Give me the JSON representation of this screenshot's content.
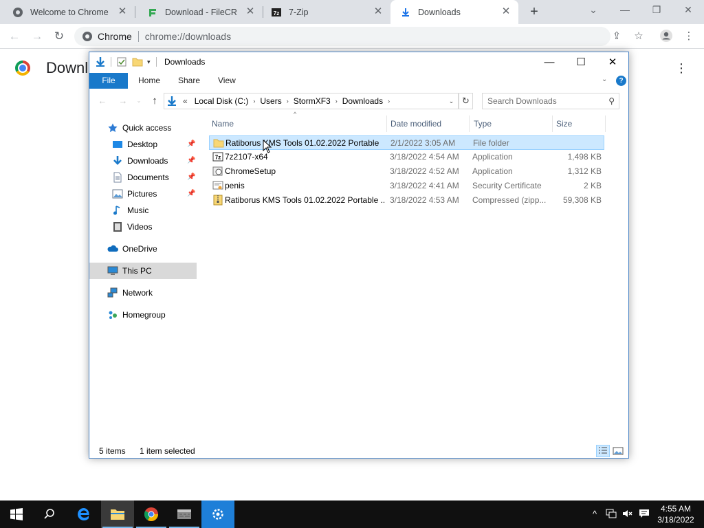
{
  "browser": {
    "tabs": [
      {
        "title": "Welcome to Chrome",
        "favicon": "chrome-icon"
      },
      {
        "title": "Download - FileCR",
        "favicon": "filecr-icon"
      },
      {
        "title": "7-Zip",
        "favicon": "7zip-icon"
      },
      {
        "title": "Downloads",
        "favicon": "download-icon",
        "active": true
      }
    ],
    "omnibox": {
      "site": "Chrome",
      "url": "chrome://downloads"
    },
    "page_title": "Downloads"
  },
  "explorer": {
    "title": "Downloads",
    "ribbon_tabs": {
      "file": "File",
      "home": "Home",
      "share": "Share",
      "view": "View"
    },
    "address": {
      "overflow": "«",
      "crumbs": [
        "Local Disk (C:)",
        "Users",
        "StormXF3",
        "Downloads"
      ]
    },
    "search_placeholder": "Search Downloads",
    "nav": {
      "quick_access": "Quick access",
      "desktop": "Desktop",
      "downloads": "Downloads",
      "documents": "Documents",
      "pictures": "Pictures",
      "music": "Music",
      "videos": "Videos",
      "onedrive": "OneDrive",
      "this_pc": "This PC",
      "network": "Network",
      "homegroup": "Homegroup"
    },
    "columns": {
      "name": "Name",
      "date": "Date modified",
      "type": "Type",
      "size": "Size"
    },
    "files": [
      {
        "name": "Ratiborus KMS Tools 01.02.2022 Portable",
        "date": "2/1/2022 3:05 AM",
        "type": "File folder",
        "size": "",
        "icon": "folder-icon",
        "selected": true
      },
      {
        "name": "7z2107-x64",
        "date": "3/18/2022 4:54 AM",
        "type": "Application",
        "size": "1,498 KB",
        "icon": "7zip-app-icon"
      },
      {
        "name": "ChromeSetup",
        "date": "3/18/2022 4:52 AM",
        "type": "Application",
        "size": "1,312 KB",
        "icon": "setup-app-icon"
      },
      {
        "name": "penis",
        "date": "3/18/2022 4:41 AM",
        "type": "Security Certificate",
        "size": "2 KB",
        "icon": "certificate-icon"
      },
      {
        "name": "Ratiborus KMS Tools 01.02.2022 Portable ...",
        "date": "3/18/2022 4:53 AM",
        "type": "Compressed (zipp...",
        "size": "59,308 KB",
        "icon": "zip-folder-icon"
      }
    ],
    "status": {
      "items": "5 items",
      "selected": "1 item selected"
    }
  },
  "taskbar": {
    "clock_time": "4:55 AM",
    "clock_date": "3/18/2022"
  },
  "colors": {
    "accent": "#1979ca",
    "selection": "#cce8ff",
    "taskbar": "#101010"
  }
}
